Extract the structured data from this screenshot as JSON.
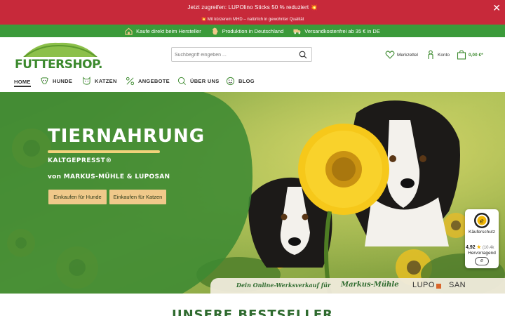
{
  "promo": {
    "line1": "Jetzt zugreifen: LUPOlino Sticks 50 % reduziert 💥",
    "line2": "💥 Mit kürzerem MHD – natürlich in gewohnter Qualität",
    "close_icon": "close-icon",
    "bg_color": "#c7293a"
  },
  "usp": {
    "items": [
      {
        "icon": "house-icon",
        "label": "Kaufe direkt beim Hersteller"
      },
      {
        "icon": "germany-map-icon",
        "label": "Produktion in Deutschland"
      },
      {
        "icon": "delivery-truck-icon",
        "label": "Versandkostenfrei ab 35 € in DE"
      }
    ],
    "bg_color": "#3b9a3a"
  },
  "header": {
    "logo_text": "FUTTERSHOP.de",
    "search_placeholder": "Suchbegriff eingeben ...",
    "wishlist_label": "Merkzettel",
    "account_label": "Konto",
    "cart_total": "0,00 €*"
  },
  "nav": {
    "items": [
      {
        "label": "HOME",
        "icon": ""
      },
      {
        "label": "HUNDE",
        "icon": "dog-icon"
      },
      {
        "label": "KATZEN",
        "icon": "cat-icon"
      },
      {
        "label": "ANGEBOTE",
        "icon": "percent-icon"
      },
      {
        "label": "ÜBER UNS",
        "icon": "speech-bubble-icon"
      },
      {
        "label": "BLOG",
        "icon": "smiley-icon"
      }
    ]
  },
  "hero": {
    "headline": "TIERNAHRUNG",
    "sub1": "KALTGEPRESST®",
    "sub2": "von MARKUS-MÜHLE & LUPOSAN",
    "button_dogs": "Einkaufen für Hunde",
    "button_cats": "Einkaufen für Katzen",
    "strip_text": "Dein Online-Werksverkauf für",
    "brand1": "Markus-Mühle",
    "brand2_a": "LUPO",
    "brand2_b": "SAN",
    "accent_color": "#f0c98a"
  },
  "trust": {
    "label": "Käuferschutz",
    "rating": "4,92",
    "count": "(10.4k",
    "rating_text": "Hervorragend",
    "button": "e"
  },
  "bestseller": {
    "title": "UNSERE BESTSELLER"
  }
}
